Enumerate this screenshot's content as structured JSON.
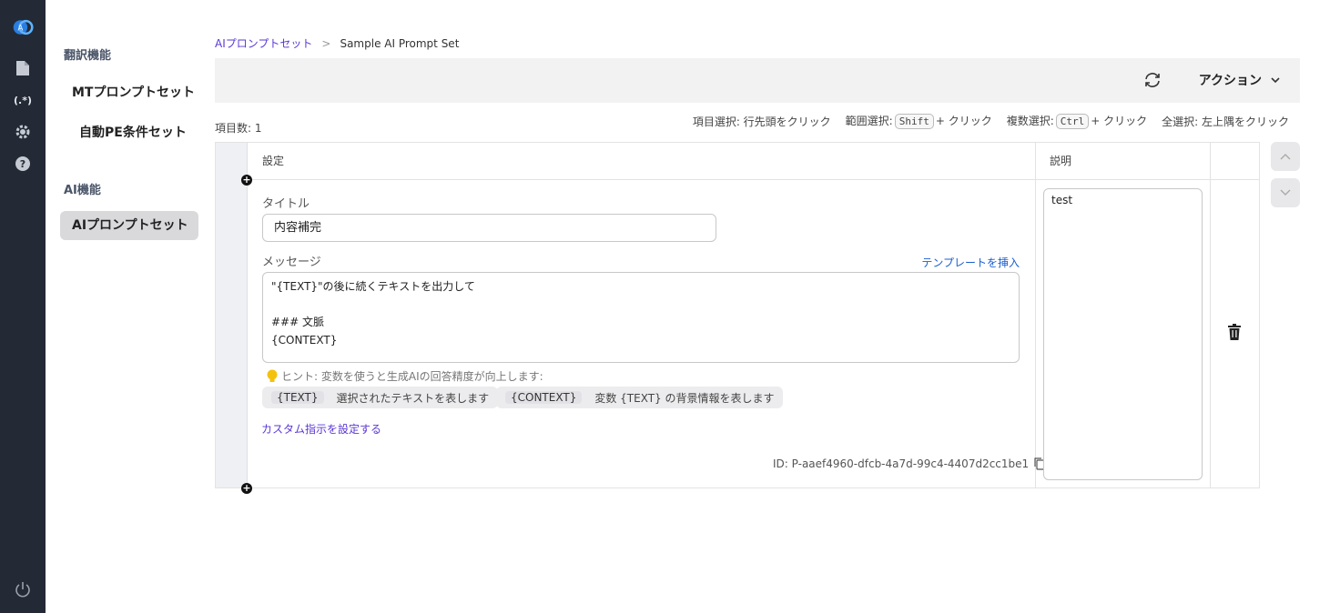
{
  "rail": {
    "icons": [
      "logo-icon",
      "document-icon",
      "regex-icon",
      "gear-icon",
      "help-icon",
      "power-icon"
    ],
    "regex_label": "(.*)"
  },
  "subnav": {
    "group1": "翻訳機能",
    "item_mt": "MTプロンプトセット",
    "item_pe": "自動PE条件セット",
    "group2": "AI機能",
    "item_ai": "AIプロンプトセット"
  },
  "breadcrumb": {
    "parent": "AIプロンプトセット",
    "sep": ">",
    "current": "Sample AI Prompt Set"
  },
  "toolbar": {
    "action_label": "アクション"
  },
  "list": {
    "count": "項目数: 1",
    "hint_item": "項目選択: 行先頭をクリック",
    "hint_range_pre": "範囲選択:",
    "hint_range_key": "Shift",
    "hint_range_post": "+ クリック",
    "hint_multi_pre": "複数選択:",
    "hint_multi_key": "Ctrl",
    "hint_multi_post": "+ クリック",
    "hint_all": "全選択: 左上隅をクリック"
  },
  "table": {
    "col_settings": "設定",
    "col_description": "説明",
    "title_label": "タイトル",
    "title_value": "内容補完",
    "message_label": "メッセージ",
    "insert_template": "テンプレートを挿入",
    "message_line1": "\"{TEXT}\"の後に続くテキストを出力して",
    "message_line2": "",
    "message_line3": "### 文脈",
    "message_line4": "{CONTEXT}",
    "hint_text": "ヒント: 変数を使うと生成AIの回答精度が向上します:",
    "var1_token": "{TEXT}",
    "var1_desc": "選択されたテキストを表します",
    "var2_token": "{CONTEXT}",
    "var2_desc": "変数 {TEXT} の背景情報を表します",
    "custom_link": "カスタム指示を設定する",
    "id_text": "ID: P-aaef4960-dfcb-4a7d-99c4-4407d2cc1be1",
    "description_value": "test"
  },
  "colors": {
    "rail_bg": "#232a35",
    "link": "#5b37d6",
    "accent_blue": "#1a5fd0"
  }
}
